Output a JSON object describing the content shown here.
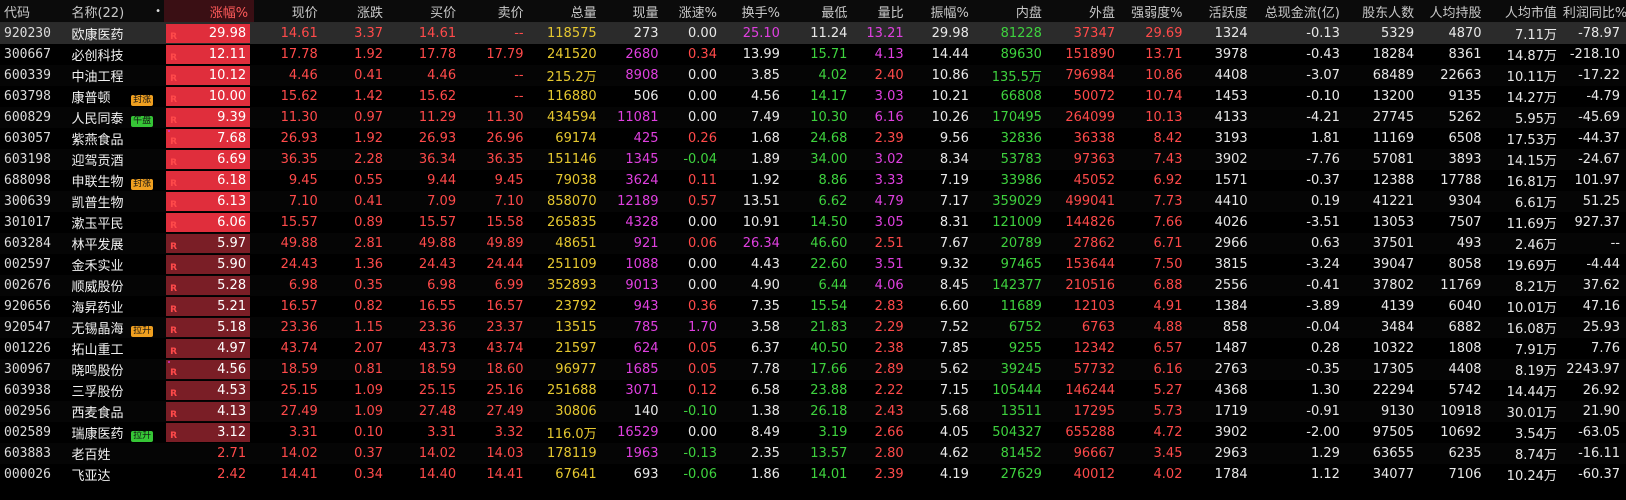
{
  "colors": {
    "up": "#ff4a4a",
    "down": "#3ed23e",
    "volume": "#e6c830",
    "lot": "#e040e0",
    "bar_bright": "#e02e3c",
    "bar_dark": "#7a1e26",
    "tag_orange": "#f0a020",
    "tag_green": "#36c636"
  },
  "headers": {
    "code": "代码",
    "name": "名称(22)",
    "dot": "•",
    "pct": "涨幅%",
    "price": "现价",
    "change": "涨跌",
    "bid": "买价",
    "ask": "卖价",
    "vol": "总量",
    "cur": "现量",
    "speed": "涨速%",
    "turnover": "换手%",
    "low": "最低",
    "vratio": "量比",
    "amp": "振幅%",
    "inner": "内盘",
    "outer": "外盘",
    "strength": "强弱度%",
    "activity": "活跃度",
    "flow": "总现金流(亿)",
    "holders": "股东人数",
    "per_hold": "人均持股",
    "per_value": "人均市值",
    "profit": "利润同比%"
  },
  "rows": [
    {
      "code": "920230",
      "name": "欧康医药",
      "tag": "",
      "tagColor": "",
      "dot": false,
      "pct": "29.98",
      "pctBar": "bright",
      "price": "14.61",
      "change": "3.37",
      "bid": "14.61",
      "ask": "--",
      "vol": "118575",
      "cur": "273",
      "curClass": "white",
      "speed": "0.00",
      "speedClass": "white",
      "turnover": "25.10",
      "turnClass": "magenta",
      "low": "11.24",
      "lowClass": "white",
      "vratio": "13.21",
      "vrClass": "magenta",
      "amp": "29.98",
      "inner": "81228",
      "outer": "37347",
      "strength": "29.69",
      "activity": "1324",
      "flow": "-0.13",
      "holders": "5329",
      "per_hold": "4870",
      "per_value": "7.11万",
      "profit": "-78.97"
    },
    {
      "code": "300667",
      "name": "必创科技",
      "tag": "",
      "tagColor": "",
      "dot": false,
      "pct": "12.11",
      "pctBar": "bright",
      "price": "17.78",
      "change": "1.92",
      "bid": "17.78",
      "ask": "17.79",
      "vol": "241520",
      "cur": "2680",
      "curClass": "magenta",
      "speed": "0.34",
      "speedClass": "red",
      "turnover": "13.99",
      "turnClass": "white",
      "low": "15.71",
      "lowClass": "green",
      "vratio": "4.13",
      "vrClass": "magenta",
      "amp": "14.44",
      "inner": "89630",
      "outer": "151890",
      "strength": "13.71",
      "activity": "3978",
      "flow": "-0.43",
      "holders": "18284",
      "per_hold": "8361",
      "per_value": "14.87万",
      "profit": "-218.10"
    },
    {
      "code": "600339",
      "name": "中油工程",
      "tag": "",
      "tagColor": "",
      "dot": false,
      "pct": "10.12",
      "pctBar": "bright",
      "price": "4.46",
      "change": "0.41",
      "bid": "4.46",
      "ask": "--",
      "vol": "215.2万",
      "cur": "8908",
      "curClass": "magenta",
      "speed": "0.00",
      "speedClass": "white",
      "turnover": "3.85",
      "turnClass": "white",
      "low": "4.02",
      "lowClass": "green",
      "vratio": "2.40",
      "vrClass": "red",
      "amp": "10.86",
      "inner": "135.5万",
      "outer": "796984",
      "strength": "10.86",
      "activity": "4408",
      "flow": "-3.07",
      "holders": "68489",
      "per_hold": "22663",
      "per_value": "10.11万",
      "profit": "-17.22"
    },
    {
      "code": "603798",
      "name": "康普顿",
      "tag": "封涨",
      "tagColor": "orange",
      "dot": false,
      "pct": "10.00",
      "pctBar": "bright",
      "price": "15.62",
      "change": "1.42",
      "bid": "15.62",
      "ask": "--",
      "vol": "116880",
      "cur": "506",
      "curClass": "white",
      "speed": "0.00",
      "speedClass": "white",
      "turnover": "4.56",
      "turnClass": "white",
      "low": "14.17",
      "lowClass": "green",
      "vratio": "3.03",
      "vrClass": "magenta",
      "amp": "10.21",
      "inner": "66808",
      "outer": "50072",
      "strength": "10.74",
      "activity": "1453",
      "flow": "-0.10",
      "holders": "13200",
      "per_hold": "9135",
      "per_value": "14.27万",
      "profit": "-4.79"
    },
    {
      "code": "600829",
      "name": "人民同泰",
      "tag": "午盘",
      "tagColor": "green",
      "dot": false,
      "pct": "9.39",
      "pctBar": "bright",
      "price": "11.30",
      "change": "0.97",
      "bid": "11.29",
      "ask": "11.30",
      "vol": "434594",
      "cur": "11081",
      "curClass": "magenta",
      "speed": "0.00",
      "speedClass": "white",
      "turnover": "7.49",
      "turnClass": "white",
      "low": "10.30",
      "lowClass": "green",
      "vratio": "6.16",
      "vrClass": "magenta",
      "amp": "10.26",
      "inner": "170495",
      "outer": "264099",
      "strength": "10.13",
      "activity": "4133",
      "flow": "-4.21",
      "holders": "27745",
      "per_hold": "5262",
      "per_value": "5.95万",
      "profit": "-45.69"
    },
    {
      "code": "603057",
      "name": "紫燕食品",
      "tag": "",
      "tagColor": "",
      "dot": true,
      "pct": "7.68",
      "pctBar": "bright",
      "price": "26.93",
      "change": "1.92",
      "bid": "26.93",
      "ask": "26.96",
      "vol": "69174",
      "cur": "425",
      "curClass": "magenta",
      "speed": "0.26",
      "speedClass": "red",
      "turnover": "1.68",
      "turnClass": "white",
      "low": "24.68",
      "lowClass": "green",
      "vratio": "2.39",
      "vrClass": "red",
      "amp": "9.56",
      "inner": "32836",
      "outer": "36338",
      "strength": "8.42",
      "activity": "3193",
      "flow": "1.81",
      "holders": "11169",
      "per_hold": "6508",
      "per_value": "17.53万",
      "profit": "-44.37"
    },
    {
      "code": "603198",
      "name": "迎驾贡酒",
      "tag": "",
      "tagColor": "",
      "dot": false,
      "pct": "6.69",
      "pctBar": "bright",
      "price": "36.35",
      "change": "2.28",
      "bid": "36.34",
      "ask": "36.35",
      "vol": "151146",
      "cur": "1345",
      "curClass": "magenta",
      "speed": "-0.04",
      "speedClass": "green",
      "turnover": "1.89",
      "turnClass": "white",
      "low": "34.00",
      "lowClass": "green",
      "vratio": "3.02",
      "vrClass": "magenta",
      "amp": "8.34",
      "inner": "53783",
      "outer": "97363",
      "strength": "7.43",
      "activity": "3902",
      "flow": "-7.76",
      "holders": "57081",
      "per_hold": "3893",
      "per_value": "14.15万",
      "profit": "-24.67"
    },
    {
      "code": "688098",
      "name": "申联生物",
      "tag": "封涨",
      "tagColor": "orange",
      "dot": false,
      "pct": "6.18",
      "pctBar": "bright",
      "price": "9.45",
      "change": "0.55",
      "bid": "9.44",
      "ask": "9.45",
      "vol": "79038",
      "cur": "3624",
      "curClass": "magenta",
      "speed": "0.11",
      "speedClass": "red",
      "turnover": "1.92",
      "turnClass": "white",
      "low": "8.86",
      "lowClass": "green",
      "vratio": "3.33",
      "vrClass": "magenta",
      "amp": "7.19",
      "inner": "33986",
      "outer": "45052",
      "strength": "6.92",
      "activity": "1571",
      "flow": "-0.37",
      "holders": "12388",
      "per_hold": "17788",
      "per_value": "16.81万",
      "profit": "101.97"
    },
    {
      "code": "300639",
      "name": "凯普生物",
      "tag": "",
      "tagColor": "",
      "dot": false,
      "pct": "6.13",
      "pctBar": "bright",
      "price": "7.10",
      "change": "0.41",
      "bid": "7.09",
      "ask": "7.10",
      "vol": "858070",
      "cur": "12189",
      "curClass": "magenta",
      "speed": "0.57",
      "speedClass": "red",
      "turnover": "13.51",
      "turnClass": "white",
      "low": "6.62",
      "lowClass": "green",
      "vratio": "4.79",
      "vrClass": "magenta",
      "amp": "7.17",
      "inner": "359029",
      "outer": "499041",
      "strength": "7.73",
      "activity": "4410",
      "flow": "0.19",
      "holders": "41221",
      "per_hold": "9304",
      "per_value": "6.61万",
      "profit": "51.25"
    },
    {
      "code": "301017",
      "name": "漱玉平民",
      "tag": "",
      "tagColor": "",
      "dot": false,
      "pct": "6.06",
      "pctBar": "bright",
      "price": "15.57",
      "change": "0.89",
      "bid": "15.57",
      "ask": "15.58",
      "vol": "265835",
      "cur": "4328",
      "curClass": "magenta",
      "speed": "0.00",
      "speedClass": "white",
      "turnover": "10.91",
      "turnClass": "white",
      "low": "14.50",
      "lowClass": "green",
      "vratio": "3.05",
      "vrClass": "magenta",
      "amp": "8.31",
      "inner": "121009",
      "outer": "144826",
      "strength": "7.66",
      "activity": "4026",
      "flow": "-3.51",
      "holders": "13053",
      "per_hold": "7507",
      "per_value": "11.69万",
      "profit": "927.37"
    },
    {
      "code": "603284",
      "name": "林平发展",
      "tag": "",
      "tagColor": "",
      "dot": false,
      "pct": "5.97",
      "pctBar": "dark",
      "price": "49.88",
      "change": "2.81",
      "bid": "49.88",
      "ask": "49.89",
      "vol": "48651",
      "cur": "921",
      "curClass": "magenta",
      "speed": "0.06",
      "speedClass": "red",
      "turnover": "26.34",
      "turnClass": "magenta",
      "low": "46.60",
      "lowClass": "green",
      "vratio": "2.51",
      "vrClass": "red",
      "amp": "7.67",
      "inner": "20789",
      "outer": "27862",
      "strength": "6.71",
      "activity": "2966",
      "flow": "0.63",
      "holders": "37501",
      "per_hold": "493",
      "per_value": "2.46万",
      "profit": "--"
    },
    {
      "code": "002597",
      "name": "金禾实业",
      "tag": "",
      "tagColor": "",
      "dot": false,
      "pct": "5.90",
      "pctBar": "dark",
      "price": "24.43",
      "change": "1.36",
      "bid": "24.43",
      "ask": "24.44",
      "vol": "251109",
      "cur": "1088",
      "curClass": "magenta",
      "speed": "0.00",
      "speedClass": "white",
      "turnover": "4.43",
      "turnClass": "white",
      "low": "22.60",
      "lowClass": "green",
      "vratio": "3.51",
      "vrClass": "magenta",
      "amp": "9.32",
      "inner": "97465",
      "outer": "153644",
      "strength": "7.50",
      "activity": "3815",
      "flow": "-3.24",
      "holders": "39047",
      "per_hold": "8058",
      "per_value": "19.69万",
      "profit": "-4.44"
    },
    {
      "code": "002676",
      "name": "顺威股份",
      "tag": "",
      "tagColor": "",
      "dot": false,
      "pct": "5.28",
      "pctBar": "dark",
      "price": "6.98",
      "change": "0.35",
      "bid": "6.98",
      "ask": "6.99",
      "vol": "352893",
      "cur": "9013",
      "curClass": "magenta",
      "speed": "0.00",
      "speedClass": "white",
      "turnover": "4.90",
      "turnClass": "white",
      "low": "6.44",
      "lowClass": "green",
      "vratio": "4.06",
      "vrClass": "magenta",
      "amp": "8.45",
      "inner": "142377",
      "outer": "210516",
      "strength": "6.88",
      "activity": "2556",
      "flow": "-0.41",
      "holders": "37802",
      "per_hold": "11769",
      "per_value": "8.21万",
      "profit": "37.62"
    },
    {
      "code": "920656",
      "name": "海昇药业",
      "tag": "",
      "tagColor": "",
      "dot": false,
      "pct": "5.21",
      "pctBar": "dark",
      "price": "16.57",
      "change": "0.82",
      "bid": "16.55",
      "ask": "16.57",
      "vol": "23792",
      "cur": "943",
      "curClass": "magenta",
      "speed": "0.36",
      "speedClass": "red",
      "turnover": "7.35",
      "turnClass": "white",
      "low": "15.54",
      "lowClass": "green",
      "vratio": "2.83",
      "vrClass": "red",
      "amp": "6.60",
      "inner": "11689",
      "outer": "12103",
      "strength": "4.91",
      "activity": "1384",
      "flow": "-3.89",
      "holders": "4139",
      "per_hold": "6040",
      "per_value": "10.01万",
      "profit": "47.16"
    },
    {
      "code": "920547",
      "name": "无锡晶海",
      "tag": "拉升",
      "tagColor": "orange",
      "dot": false,
      "pct": "5.18",
      "pctBar": "dark",
      "price": "23.36",
      "change": "1.15",
      "bid": "23.36",
      "ask": "23.37",
      "vol": "13515",
      "cur": "785",
      "curClass": "magenta",
      "speed": "1.70",
      "speedClass": "magenta",
      "turnover": "3.58",
      "turnClass": "white",
      "low": "21.83",
      "lowClass": "green",
      "vratio": "2.29",
      "vrClass": "red",
      "amp": "7.52",
      "inner": "6752",
      "outer": "6763",
      "strength": "4.88",
      "activity": "858",
      "flow": "-0.04",
      "holders": "3484",
      "per_hold": "6882",
      "per_value": "16.08万",
      "profit": "25.93"
    },
    {
      "code": "001226",
      "name": "拓山重工",
      "tag": "",
      "tagColor": "",
      "dot": false,
      "pct": "4.97",
      "pctBar": "dark",
      "price": "43.74",
      "change": "2.07",
      "bid": "43.73",
      "ask": "43.74",
      "vol": "21597",
      "cur": "624",
      "curClass": "magenta",
      "speed": "0.05",
      "speedClass": "red",
      "turnover": "6.37",
      "turnClass": "white",
      "low": "40.50",
      "lowClass": "green",
      "vratio": "2.38",
      "vrClass": "red",
      "amp": "7.85",
      "inner": "9255",
      "outer": "12342",
      "strength": "6.57",
      "activity": "1487",
      "flow": "0.28",
      "holders": "10322",
      "per_hold": "1808",
      "per_value": "7.91万",
      "profit": "7.76"
    },
    {
      "code": "300967",
      "name": "晓鸣股份",
      "tag": "",
      "tagColor": "",
      "dot": true,
      "pct": "4.56",
      "pctBar": "dark",
      "price": "18.59",
      "change": "0.81",
      "bid": "18.59",
      "ask": "18.60",
      "vol": "96977",
      "cur": "1685",
      "curClass": "magenta",
      "speed": "0.05",
      "speedClass": "red",
      "turnover": "7.78",
      "turnClass": "white",
      "low": "17.66",
      "lowClass": "green",
      "vratio": "2.89",
      "vrClass": "red",
      "amp": "5.62",
      "inner": "39245",
      "outer": "57732",
      "strength": "6.16",
      "activity": "2763",
      "flow": "-0.35",
      "holders": "17305",
      "per_hold": "4408",
      "per_value": "8.19万",
      "profit": "2243.97"
    },
    {
      "code": "603938",
      "name": "三孚股份",
      "tag": "",
      "tagColor": "",
      "dot": false,
      "pct": "4.53",
      "pctBar": "dark",
      "price": "25.15",
      "change": "1.09",
      "bid": "25.15",
      "ask": "25.16",
      "vol": "251688",
      "cur": "3071",
      "curClass": "magenta",
      "speed": "0.12",
      "speedClass": "red",
      "turnover": "6.58",
      "turnClass": "white",
      "low": "23.88",
      "lowClass": "green",
      "vratio": "2.22",
      "vrClass": "red",
      "amp": "7.15",
      "inner": "105444",
      "outer": "146244",
      "strength": "5.27",
      "activity": "4368",
      "flow": "1.30",
      "holders": "22294",
      "per_hold": "5742",
      "per_value": "14.44万",
      "profit": "26.92"
    },
    {
      "code": "002956",
      "name": "西麦食品",
      "tag": "",
      "tagColor": "",
      "dot": false,
      "pct": "4.13",
      "pctBar": "dark",
      "price": "27.49",
      "change": "1.09",
      "bid": "27.48",
      "ask": "27.49",
      "vol": "30806",
      "cur": "140",
      "curClass": "white",
      "speed": "-0.10",
      "speedClass": "green",
      "turnover": "1.38",
      "turnClass": "white",
      "low": "26.18",
      "lowClass": "green",
      "vratio": "2.43",
      "vrClass": "red",
      "amp": "5.68",
      "inner": "13511",
      "outer": "17295",
      "strength": "5.73",
      "activity": "1719",
      "flow": "-0.91",
      "holders": "9130",
      "per_hold": "10918",
      "per_value": "30.01万",
      "profit": "21.90"
    },
    {
      "code": "002589",
      "name": "瑞康医药",
      "tag": "拉升",
      "tagColor": "green",
      "dot": false,
      "pct": "3.12",
      "pctBar": "dark",
      "price": "3.31",
      "change": "0.10",
      "bid": "3.31",
      "ask": "3.32",
      "vol": "116.0万",
      "cur": "16529",
      "curClass": "magenta",
      "speed": "0.00",
      "speedClass": "white",
      "turnover": "8.49",
      "turnClass": "white",
      "low": "3.19",
      "lowClass": "green",
      "vratio": "2.66",
      "vrClass": "red",
      "amp": "4.05",
      "inner": "504327",
      "outer": "655288",
      "strength": "4.72",
      "activity": "3902",
      "flow": "-2.00",
      "holders": "97505",
      "per_hold": "10692",
      "per_value": "3.54万",
      "profit": "-63.05"
    },
    {
      "code": "603883",
      "name": "老百姓",
      "tag": "",
      "tagColor": "",
      "dot": false,
      "pct": "2.71",
      "pctBar": "none",
      "price": "14.02",
      "change": "0.37",
      "bid": "14.02",
      "ask": "14.03",
      "vol": "178119",
      "cur": "1963",
      "curClass": "magenta",
      "speed": "-0.13",
      "speedClass": "green",
      "turnover": "2.35",
      "turnClass": "white",
      "low": "13.57",
      "lowClass": "green",
      "vratio": "2.80",
      "vrClass": "red",
      "amp": "4.62",
      "inner": "81452",
      "outer": "96667",
      "strength": "3.45",
      "activity": "2963",
      "flow": "1.29",
      "holders": "63655",
      "per_hold": "6235",
      "per_value": "8.74万",
      "profit": "-16.11"
    },
    {
      "code": "000026",
      "name": "飞亚达",
      "tag": "",
      "tagColor": "",
      "dot": false,
      "pct": "2.42",
      "pctBar": "none",
      "price": "14.41",
      "change": "0.34",
      "bid": "14.40",
      "ask": "14.41",
      "vol": "67641",
      "cur": "693",
      "curClass": "white",
      "speed": "-0.06",
      "speedClass": "green",
      "turnover": "1.86",
      "turnClass": "white",
      "low": "14.01",
      "lowClass": "green",
      "vratio": "2.39",
      "vrClass": "red",
      "amp": "4.19",
      "inner": "27629",
      "outer": "40012",
      "strength": "4.02",
      "activity": "1784",
      "flow": "1.12",
      "holders": "34077",
      "per_hold": "7106",
      "per_value": "10.24万",
      "profit": "-60.37"
    }
  ]
}
